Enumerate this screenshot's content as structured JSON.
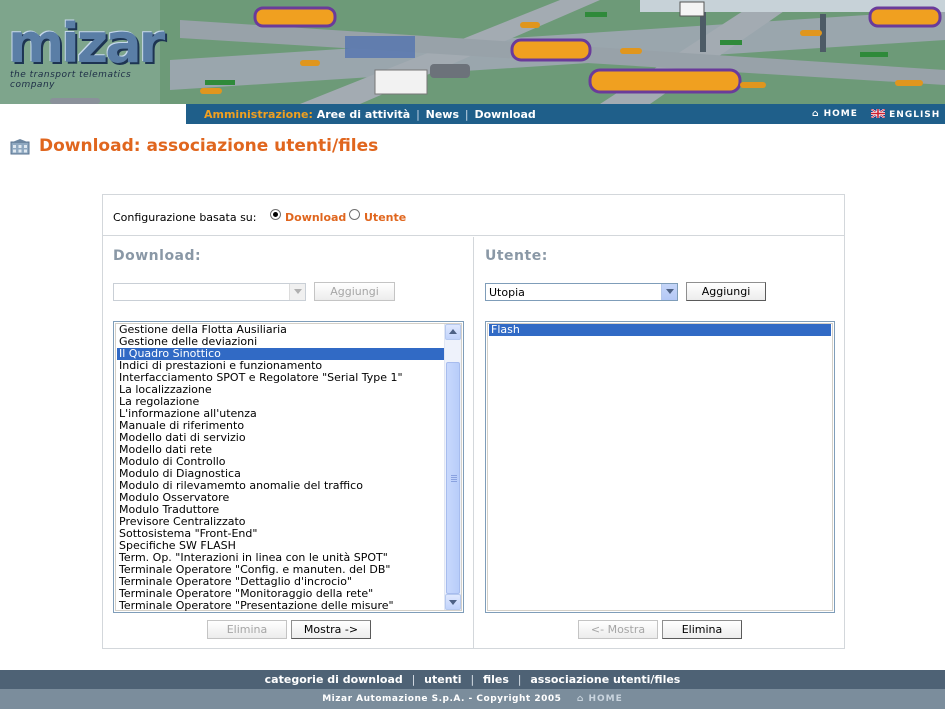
{
  "header": {
    "logo_text": "mizar",
    "logo_tagline": "the transport telematics company",
    "nav": {
      "admin_label": "Amministrazione:",
      "links": [
        "Aree di attività",
        "News",
        "Download"
      ]
    },
    "home_label": "HOME",
    "english_label": "ENGLISH"
  },
  "page": {
    "title": "Download: associazione utenti/files"
  },
  "config": {
    "label": "Configurazione basata su:",
    "options": [
      {
        "label": "Download",
        "checked": true
      },
      {
        "label": "Utente",
        "checked": false
      }
    ]
  },
  "download_panel": {
    "heading": "Download:",
    "select_value": "",
    "add_button": "Aggiungi",
    "items": [
      "Gestione della Flotta Ausiliaria",
      "Gestione delle deviazioni",
      "Il Quadro Sinottico",
      "Indici di prestazioni e funzionamento",
      "Interfacciamento SPOT e Regolatore \"Serial Type 1\"",
      "La localizzazione",
      "La regolazione",
      "L'informazione all'utenza",
      "Manuale di riferimento",
      "Modello dati di servizio",
      "Modello dati rete",
      "Modulo di Controllo",
      "Modulo di Diagnostica",
      "Modulo di rilevamemto anomalie del traffico",
      "Modulo Osservatore",
      "Modulo Traduttore",
      "Previsore Centralizzato",
      "Sottosistema \"Front-End\"",
      "Specifiche SW FLASH",
      "Term. Op. \"Interazioni in linea con le unità SPOT\"",
      "Terminale Operatore \"Config. e manuten. del DB\"",
      "Terminale Operatore \"Dettaglio d'incrocio\"",
      "Terminale Operatore \"Monitoraggio della rete\"",
      "Terminale Operatore \"Presentazione delle misure\""
    ],
    "selected_item": "Il Quadro Sinottico",
    "delete_button": "Elimina",
    "show_button": "Mostra ->"
  },
  "user_panel": {
    "heading": "Utente:",
    "select_value": "Utopia",
    "add_button": "Aggiungi",
    "items": [
      "Flash"
    ],
    "selected_item": "Flash",
    "show_button": "<- Mostra",
    "delete_button": "Elimina"
  },
  "footer": {
    "links": [
      "categorie di download",
      "utenti",
      "files",
      "associazione utenti/files"
    ],
    "copyright": "Mizar Automazione S.p.A. - Copyright 2005",
    "home_label": "HOME"
  },
  "colors": {
    "accent_orange": "#e0661e",
    "nav_blue": "#1f5f8a",
    "selection_blue": "#316ac5",
    "footer_dark": "#4e6275",
    "footer_light": "#7b8d9c"
  }
}
